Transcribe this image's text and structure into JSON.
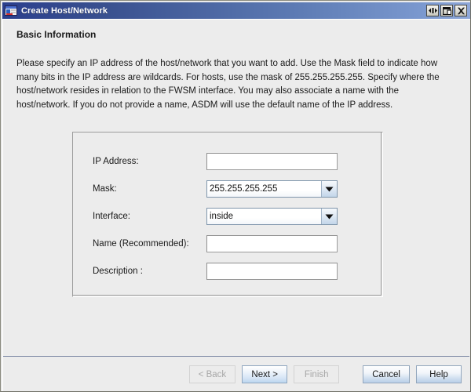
{
  "window": {
    "title": "Create Host/Network",
    "icon": "host-network-icon",
    "controls": [
      {
        "name": "minimize-button",
        "glyph": "minimize-icon"
      },
      {
        "name": "maximize-button",
        "glyph": "maximize-icon"
      },
      {
        "name": "close-button",
        "glyph": "close-icon"
      }
    ]
  },
  "page": {
    "header": "Basic Information",
    "description": "Please specify an IP address of the host/network that you want to add. Use the Mask field to indicate how many bits in the IP address are wildcards. For hosts, use the mask of 255.255.255.255. Specify where the host/network resides in relation to the FWSM interface. You may also associate a name with the host/network. If you do not provide a name, ASDM will use the default name of the IP address."
  },
  "form": {
    "fields": [
      {
        "name": "ip-address",
        "label": "IP Address:",
        "type": "text",
        "value": "",
        "placeholder": ""
      },
      {
        "name": "mask",
        "label": "Mask:",
        "type": "combo",
        "value": "255.255.255.255"
      },
      {
        "name": "interface",
        "label": "Interface:",
        "type": "combo",
        "value": "inside"
      },
      {
        "name": "name",
        "label": "Name (Recommended):",
        "type": "text",
        "value": "",
        "placeholder": ""
      },
      {
        "name": "description",
        "label": "Description :",
        "type": "text",
        "value": "",
        "placeholder": ""
      }
    ]
  },
  "buttons": [
    {
      "name": "back-button",
      "label": "< Back",
      "state": "disabled"
    },
    {
      "name": "next-button",
      "label": "Next >",
      "state": "default"
    },
    {
      "name": "finish-button",
      "label": "Finish",
      "state": "disabled"
    },
    {
      "name": "cancel-button",
      "label": "Cancel",
      "state": "normal"
    },
    {
      "name": "help-button",
      "label": "Help",
      "state": "normal"
    }
  ],
  "colors": {
    "titlebar_left": "#2b3f8d",
    "titlebar_right": "#8fa8d8",
    "dialog_background": "#ececec",
    "separator": "#7f8ba6",
    "combo_border": "#7f95ab"
  }
}
